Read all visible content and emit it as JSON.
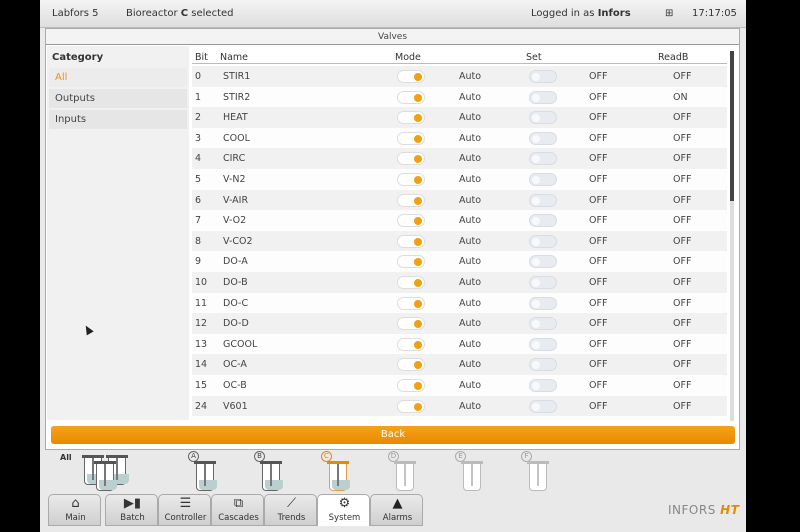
{
  "topbar": {
    "app_name": "Labfors 5",
    "reactor_prefix": "Bioreactor ",
    "reactor_id": "C",
    "reactor_suffix": " selected",
    "login_prefix": "Logged in as ",
    "login_user": "Infors",
    "time": "17:17:05"
  },
  "panel": {
    "title": "Valves"
  },
  "sidebar": {
    "header": "Category",
    "items": [
      {
        "label": "All",
        "active": true
      },
      {
        "label": "Outputs",
        "active": false
      },
      {
        "label": "Inputs",
        "active": false
      }
    ]
  },
  "table": {
    "headers": {
      "bit": "Bit",
      "name": "Name",
      "mode": "Mode",
      "set": "Set",
      "readb": "ReadB"
    },
    "rows": [
      {
        "bit": "0",
        "name": "STIR1",
        "mode": "Auto",
        "set": "OFF",
        "readb": "OFF"
      },
      {
        "bit": "1",
        "name": "STIR2",
        "mode": "Auto",
        "set": "OFF",
        "readb": "ON"
      },
      {
        "bit": "2",
        "name": "HEAT",
        "mode": "Auto",
        "set": "OFF",
        "readb": "OFF"
      },
      {
        "bit": "3",
        "name": "COOL",
        "mode": "Auto",
        "set": "OFF",
        "readb": "OFF"
      },
      {
        "bit": "4",
        "name": "CIRC",
        "mode": "Auto",
        "set": "OFF",
        "readb": "OFF"
      },
      {
        "bit": "5",
        "name": "V-N2",
        "mode": "Auto",
        "set": "OFF",
        "readb": "OFF"
      },
      {
        "bit": "6",
        "name": "V-AIR",
        "mode": "Auto",
        "set": "OFF",
        "readb": "OFF"
      },
      {
        "bit": "7",
        "name": "V-O2",
        "mode": "Auto",
        "set": "OFF",
        "readb": "OFF"
      },
      {
        "bit": "8",
        "name": "V-CO2",
        "mode": "Auto",
        "set": "OFF",
        "readb": "OFF"
      },
      {
        "bit": "9",
        "name": "DO-A",
        "mode": "Auto",
        "set": "OFF",
        "readb": "OFF"
      },
      {
        "bit": "10",
        "name": "DO-B",
        "mode": "Auto",
        "set": "OFF",
        "readb": "OFF"
      },
      {
        "bit": "11",
        "name": "DO-C",
        "mode": "Auto",
        "set": "OFF",
        "readb": "OFF"
      },
      {
        "bit": "12",
        "name": "DO-D",
        "mode": "Auto",
        "set": "OFF",
        "readb": "OFF"
      },
      {
        "bit": "13",
        "name": "GCOOL",
        "mode": "Auto",
        "set": "OFF",
        "readb": "OFF"
      },
      {
        "bit": "14",
        "name": "OC-A",
        "mode": "Auto",
        "set": "OFF",
        "readb": "OFF"
      },
      {
        "bit": "15",
        "name": "OC-B",
        "mode": "Auto",
        "set": "OFF",
        "readb": "OFF"
      },
      {
        "bit": "24",
        "name": "V601",
        "mode": "Auto",
        "set": "OFF",
        "readb": "OFF"
      }
    ]
  },
  "back_button": "Back",
  "reactors": {
    "all_label": "All",
    "items": [
      {
        "id": "A",
        "state": "active"
      },
      {
        "id": "B",
        "state": "active"
      },
      {
        "id": "C",
        "state": "selected"
      },
      {
        "id": "D",
        "state": "inactive"
      },
      {
        "id": "E",
        "state": "inactive"
      },
      {
        "id": "F",
        "state": "inactive"
      }
    ]
  },
  "nav": {
    "items": [
      {
        "label": "Main",
        "icon": "home-icon",
        "glyph": "⌂",
        "active": false
      },
      {
        "label": "Batch",
        "icon": "batch-icon",
        "glyph": "▶▮",
        "active": false
      },
      {
        "label": "Controller",
        "icon": "controller-icon",
        "glyph": "☰",
        "active": false
      },
      {
        "label": "Cascades",
        "icon": "cascades-icon",
        "glyph": "⧉",
        "active": false
      },
      {
        "label": "Trends",
        "icon": "trends-icon",
        "glyph": "⟋",
        "active": false
      },
      {
        "label": "System",
        "icon": "gear-icon",
        "glyph": "⚙",
        "active": true
      },
      {
        "label": "Alarms",
        "icon": "warning-icon",
        "glyph": "▲",
        "active": false
      }
    ]
  },
  "brand": {
    "name": "INFORS",
    "suffix": "HT"
  },
  "colors": {
    "accent": "#f0a010",
    "background": "#e9e9e9",
    "panel": "#ffffff"
  }
}
